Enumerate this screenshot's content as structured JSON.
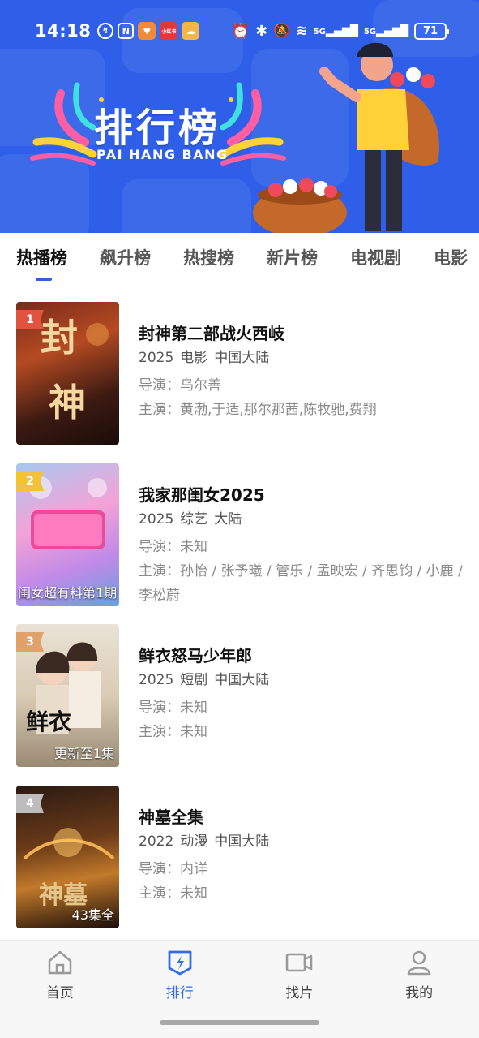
{
  "status_bar": {
    "time": "14:18",
    "battery": "71",
    "network": [
      "5G",
      "5G"
    ],
    "app_badge": "小红书"
  },
  "hero": {
    "title": "排行榜",
    "subtitle": "PAI HANG BANG",
    "colors": {
      "background": "#2f5fe8"
    }
  },
  "tabs": [
    {
      "label": "热播榜",
      "active": true
    },
    {
      "label": "飙升榜",
      "active": false
    },
    {
      "label": "热搜榜",
      "active": false
    },
    {
      "label": "新片榜",
      "active": false
    },
    {
      "label": "电视剧",
      "active": false
    },
    {
      "label": "电影",
      "active": false
    }
  ],
  "items": [
    {
      "rank": "1",
      "rank_color": "#e0533f",
      "title": "封神第二部战火西岐",
      "year": "2025",
      "genre": "电影",
      "region": "中国大陆",
      "director": "导演：乌尔善",
      "cast": "主演：黄渤,于适,那尔那茜,陈牧驰,费翔",
      "poster_caption": ""
    },
    {
      "rank": "2",
      "rank_color": "#f2c23a",
      "title": "我家那闺女2025",
      "year": "2025",
      "genre": "综艺",
      "region": "大陆",
      "director": "导演：未知",
      "cast": "主演：孙怡 / 张予曦 / 管乐 / 孟映宏 / 齐思钧 / 小鹿 / 李松蔚",
      "poster_caption": "闺女超有料第1期"
    },
    {
      "rank": "3",
      "rank_color": "#e0a26a",
      "title": "鲜衣怒马少年郎",
      "year": "2025",
      "genre": "短剧",
      "region": "中国大陆",
      "director": "导演：未知",
      "cast": "主演：未知",
      "poster_caption": "更新至1集"
    },
    {
      "rank": "4",
      "rank_color": "#bdbdbd",
      "title": "神墓全集",
      "year": "2022",
      "genre": "动漫",
      "region": "中国大陆",
      "director": "导演：内详",
      "cast": "主演：未知",
      "poster_caption": "43集全"
    }
  ],
  "bottom_nav": [
    {
      "label": "首页",
      "icon": "home-icon",
      "active": false
    },
    {
      "label": "排行",
      "icon": "ranking-shield-icon",
      "active": true
    },
    {
      "label": "找片",
      "icon": "video-camera-icon",
      "active": false
    },
    {
      "label": "我的",
      "icon": "user-icon",
      "active": false
    }
  ],
  "accent_color": "#2f6ee8"
}
